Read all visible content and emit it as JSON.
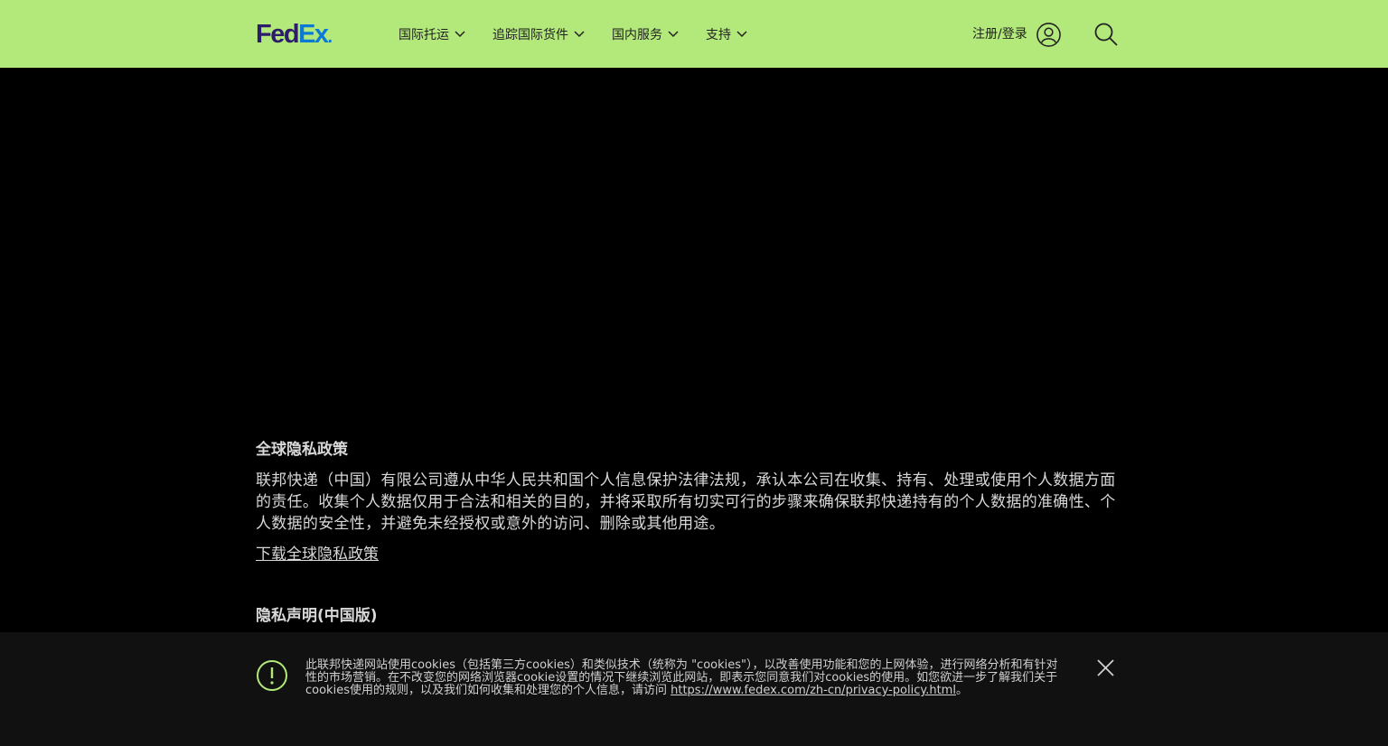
{
  "header": {
    "logo_fed": "Fed",
    "logo_ex": "Ex",
    "logo_dot": ".",
    "nav": [
      {
        "label": "国际托运"
      },
      {
        "label": "追踪国际货件"
      },
      {
        "label": "国内服务"
      },
      {
        "label": "支持"
      }
    ],
    "signin_label": "注册/登录"
  },
  "content": {
    "global_title": "全球隐私政策",
    "global_paragraph": "联邦快递（中国）有限公司遵从中华人民共和国个人信息保护法律法规，承认本公司在收集、持有、处理或使用个人数据方面的责任。收集个人数据仅用于合法和相关的目的，并将采取所有切实可行的步骤来确保联邦快递持有的个人数据的准确性、个人数据的安全性，并避免未经授权或意外的访问、删除或其他用途。",
    "download_link": "下载全球隐私政策",
    "china_title": "隐私声明(中国版)"
  },
  "cookie_banner": {
    "text": "此联邦快递网站使用cookies（包括第三方cookies）和类似技术（统称为 \"cookies\"），以改善使用功能和您的上网体验，进行网络分析和有针对性的市场营销。在不改变您的网络浏览器cookie设置的情况下继续浏览此网站，即表示您同意我们对cookies的使用。如您欲进一步了解我们关于cookies使用的规则，以及我们如何收集和处理您的个人信息，请访问 ",
    "link": "https://www.fedex.com/zh-cn/privacy-policy.html",
    "suffix": "。"
  },
  "colors": {
    "header_bg": "#b3e87a",
    "page_bg": "#000000",
    "banner_bg": "#111111",
    "accent_green": "#b3e87a"
  },
  "icons": [
    "chevron-down-icon",
    "user-icon",
    "search-icon",
    "alert-icon",
    "close-icon"
  ]
}
